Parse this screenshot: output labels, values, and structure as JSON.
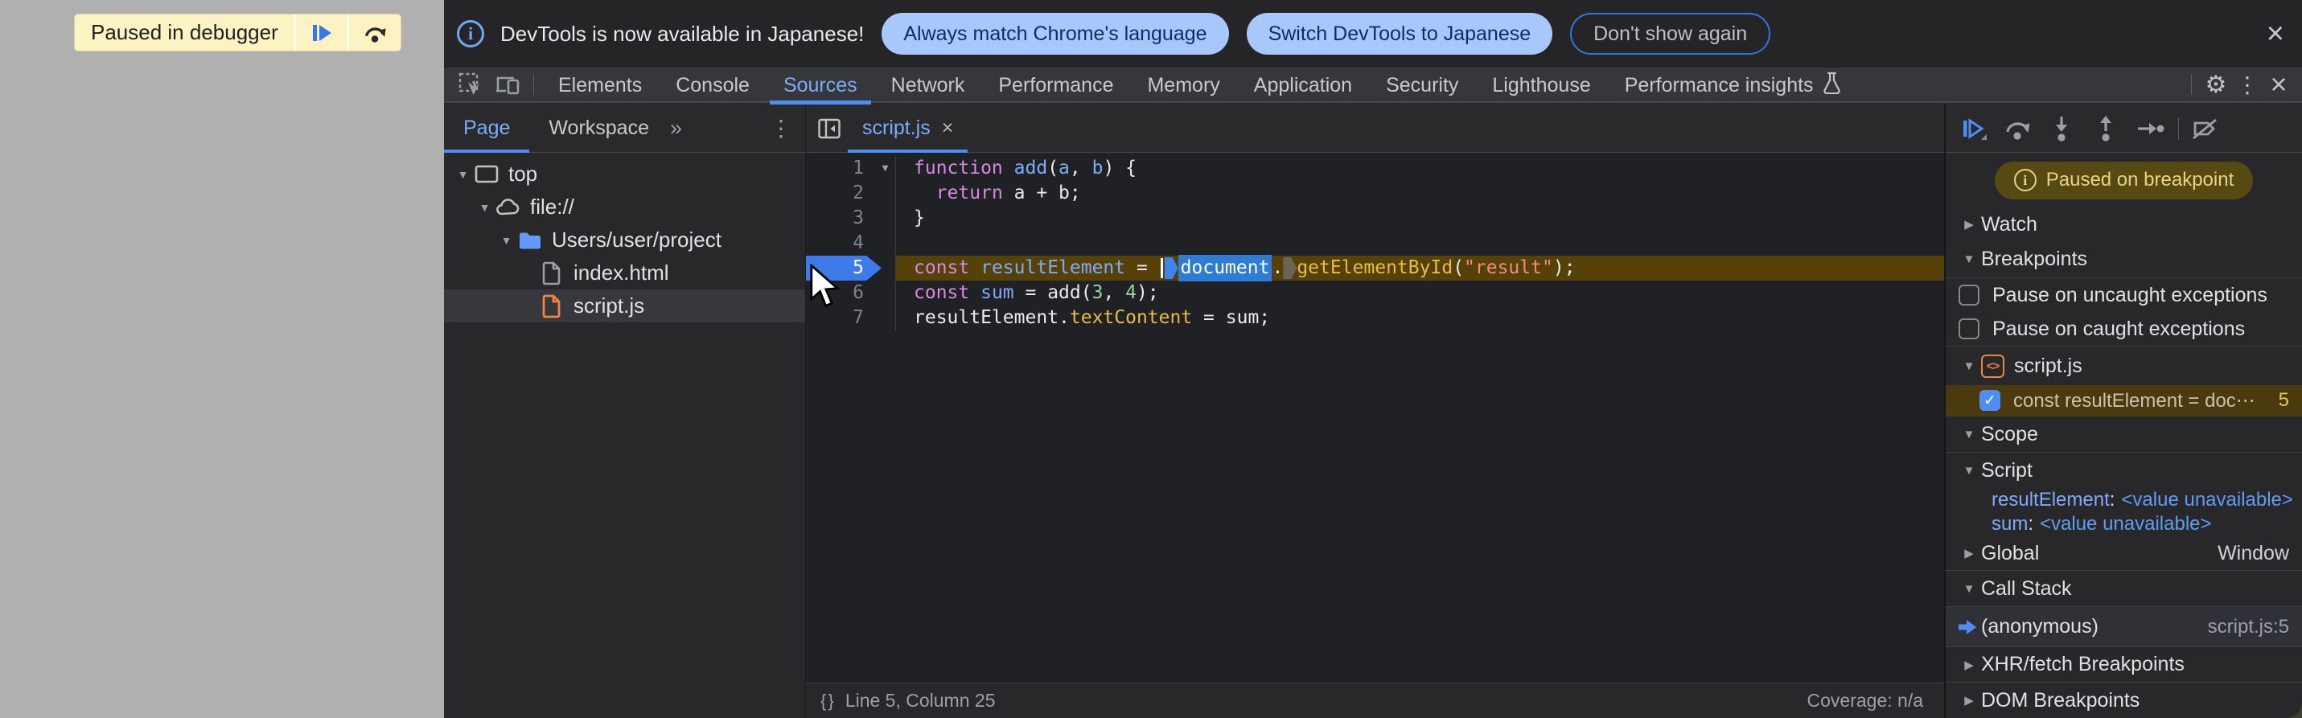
{
  "colors": {
    "accent_blue": "#4e8df6",
    "link_blue": "#7cacf8",
    "exec_line_bg": "#564208",
    "badge_bg": "#574912",
    "pill_bg": "#a8c7fa",
    "page_gray": "#b0b0b0",
    "corner_olive": "#3e3f24"
  },
  "webpage": {
    "paused_banner": "Paused in debugger"
  },
  "infobar": {
    "info_icon": "i",
    "message": "DevTools is now available in Japanese!",
    "primary_button": "Always match Chrome's language",
    "secondary_button": "Switch DevTools to Japanese",
    "dismiss_button": "Don't show again",
    "close_icon": "×"
  },
  "devtools_tabs": {
    "items": [
      "Elements",
      "Console",
      "Sources",
      "Network",
      "Performance",
      "Memory",
      "Application",
      "Security",
      "Lighthouse",
      "Performance insights"
    ],
    "selected": "Sources",
    "gear_icon": "⚙",
    "kebab_icon": "⋮",
    "close_icon": "×"
  },
  "navigator": {
    "tabs": [
      "Page",
      "Workspace"
    ],
    "selected_tab": "Page",
    "overflow_icon": "»",
    "kebab_icon": "⋮",
    "tree": [
      {
        "label": "top",
        "icon": "frame",
        "depth": 0,
        "expanded": true
      },
      {
        "label": "file://",
        "icon": "cloud",
        "depth": 1,
        "expanded": true
      },
      {
        "label": "Users/user/project",
        "icon": "folder",
        "depth": 2,
        "expanded": true
      },
      {
        "label": "index.html",
        "icon": "file",
        "depth": 3
      },
      {
        "label": "script.js",
        "icon": "file-orange",
        "depth": 3,
        "selected": true
      }
    ]
  },
  "editor": {
    "open_tab": "script.js",
    "tab_close_icon": "×",
    "current_line": 5,
    "status": {
      "braces_icon": "{ }",
      "left": "Line 5, Column 25",
      "right": "Coverage: n/a"
    },
    "lines": [
      {
        "num": 1,
        "fold": true,
        "tokens": [
          [
            "function",
            "kw"
          ],
          [
            " ",
            ""
          ],
          [
            "add",
            "var"
          ],
          [
            "(",
            ""
          ],
          [
            "a",
            "var"
          ],
          [
            ", ",
            ""
          ],
          [
            "b",
            "var"
          ],
          [
            ") {",
            ""
          ]
        ]
      },
      {
        "num": 2,
        "tokens": [
          [
            "  ",
            ""
          ],
          [
            "return",
            "kw"
          ],
          [
            " a + b;",
            ""
          ]
        ]
      },
      {
        "num": 3,
        "tokens": [
          [
            "}",
            ""
          ]
        ]
      },
      {
        "num": 4,
        "tokens": []
      },
      {
        "num": 5,
        "exec": true,
        "tokens": [
          [
            "const",
            "kw"
          ],
          [
            " ",
            ""
          ],
          [
            "resultElement",
            "var"
          ],
          [
            " = ",
            ""
          ],
          [
            "",
            "caret"
          ],
          [
            "",
            "chip-blue"
          ],
          [
            "document",
            "sel"
          ],
          [
            ".",
            ""
          ],
          [
            "",
            "chip-gray"
          ],
          [
            "getElementById",
            "fn"
          ],
          [
            "(",
            ""
          ],
          [
            "\"result\"",
            "str"
          ],
          [
            ")",
            ""
          ],
          [
            ";",
            ""
          ]
        ]
      },
      {
        "num": 6,
        "tokens": [
          [
            "const",
            "kw"
          ],
          [
            " ",
            ""
          ],
          [
            "sum",
            "var"
          ],
          [
            " = add(",
            ""
          ],
          [
            "3",
            "num"
          ],
          [
            ", ",
            ""
          ],
          [
            "4",
            "num"
          ],
          [
            ");",
            ""
          ]
        ]
      },
      {
        "num": 7,
        "tokens": [
          [
            "resultElement.",
            ""
          ],
          [
            "textContent",
            "fn"
          ],
          [
            " = sum;",
            ""
          ]
        ]
      }
    ]
  },
  "debugger_sidebar": {
    "toolbar_icons": [
      "resume",
      "step-over",
      "step-into",
      "step-out",
      "step",
      "deactivate-breakpoints"
    ],
    "paused_badge": "Paused on breakpoint",
    "watch_label": "Watch",
    "breakpoints_label": "Breakpoints",
    "exception_checkboxes": [
      {
        "label": "Pause on uncaught exceptions",
        "checked": false
      },
      {
        "label": "Pause on caught exceptions",
        "checked": false
      }
    ],
    "breakpoint_groups": [
      {
        "file": "script.js",
        "items": [
          {
            "checked": true,
            "snippet": "const resultElement = doc⋯",
            "line": "5"
          }
        ]
      }
    ],
    "scope_label": "Scope",
    "scope_tree": [
      {
        "name": "Script",
        "expanded": true,
        "vars": [
          {
            "name": "resultElement",
            "value": "<value unavailable>"
          },
          {
            "name": "sum",
            "value": "<value unavailable>"
          }
        ]
      },
      {
        "name": "Global",
        "expanded": false,
        "summary": "Window"
      }
    ],
    "call_stack_label": "Call Stack",
    "frames": [
      {
        "name": "(anonymous)",
        "location": "script.js:5",
        "active": true
      }
    ],
    "xhr_label": "XHR/fetch Breakpoints",
    "dom_label": "DOM Breakpoints",
    "check_glyph": "✓",
    "collapsed_glyph": "▶",
    "expanded_glyph": "▼"
  }
}
